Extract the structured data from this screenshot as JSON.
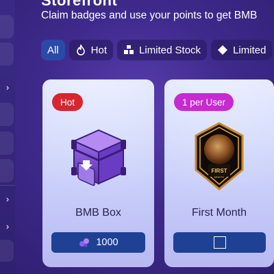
{
  "header": {
    "title_partial": "Storefront",
    "subtitle": "Claim badges and use your points to get BMB"
  },
  "filters": [
    {
      "label": "All",
      "icon": "none",
      "active": true
    },
    {
      "label": "Hot",
      "icon": "fire-icon",
      "active": false
    },
    {
      "label": "Limited Stock",
      "icon": "stock-icon",
      "active": false
    },
    {
      "label": "Limited",
      "icon": "diamond-icon",
      "active": false
    }
  ],
  "cards": [
    {
      "tag": "Hot",
      "tag_color": "#d6262f",
      "name": "BMB Box",
      "price": "1000",
      "image": "purple-chest"
    },
    {
      "tag": "1 per User",
      "tag_color": "#c62ad0",
      "name": "First Month",
      "price": "",
      "image": "first-month-badge"
    }
  ],
  "colors": {
    "accent": "#2b4aa8",
    "button": "#1f4194",
    "background": "#3f2a8c"
  }
}
